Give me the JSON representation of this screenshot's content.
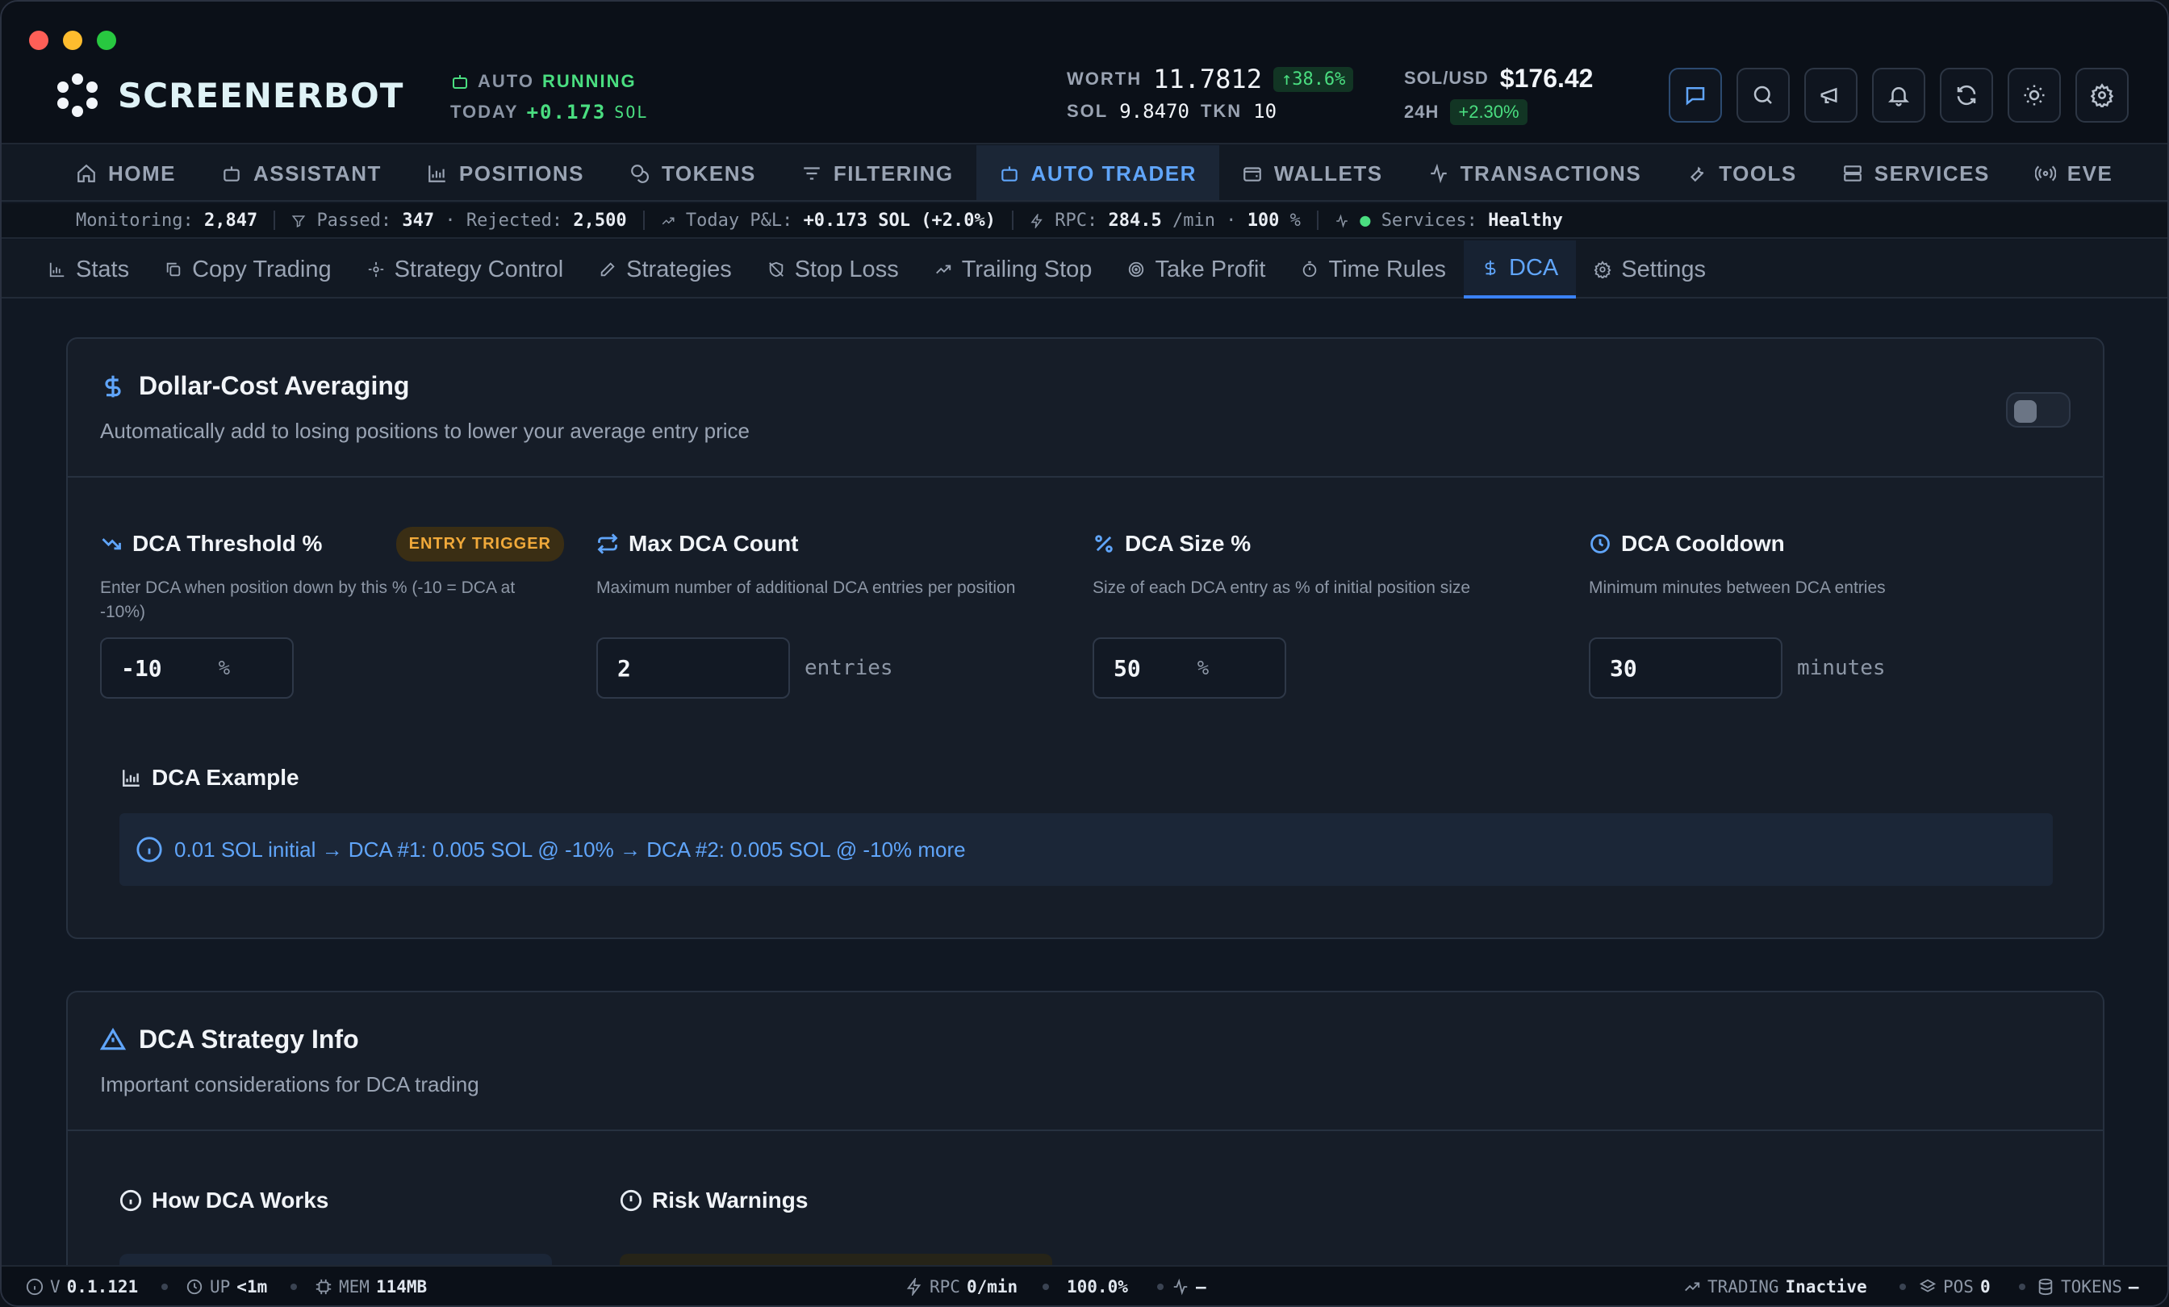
{
  "header": {
    "logo": "SCREENERBOT",
    "auto": {
      "label": "AUTO",
      "state": "RUNNING"
    },
    "today": {
      "label": "TODAY",
      "value": "+0.173",
      "unit": "SOL"
    },
    "worth": {
      "label": "WORTH",
      "value": "11.7812",
      "change": "↑38.6%"
    },
    "sol": {
      "label": "SOL",
      "value": "9.8470",
      "tkn_label": "TKN",
      "tkn_value": "10"
    },
    "solusd": {
      "label": "SOL/USD",
      "value": "$176.42",
      "h24_label": "24H",
      "h24_value": "+2.30%"
    },
    "icon_buttons": [
      "chat-icon",
      "search-icon",
      "megaphone-icon",
      "bell-icon",
      "refresh-icon",
      "sun-icon",
      "gear-icon"
    ]
  },
  "nav": {
    "items": [
      {
        "label": "HOME",
        "icon": "home-icon"
      },
      {
        "label": "ASSISTANT",
        "icon": "bot-icon"
      },
      {
        "label": "POSITIONS",
        "icon": "chart-icon"
      },
      {
        "label": "TOKENS",
        "icon": "coins-icon"
      },
      {
        "label": "FILTERING",
        "icon": "filter-icon"
      },
      {
        "label": "AUTO TRADER",
        "icon": "bot-icon",
        "active": true
      },
      {
        "label": "WALLETS",
        "icon": "wallet-icon"
      },
      {
        "label": "TRANSACTIONS",
        "icon": "activity-icon"
      },
      {
        "label": "TOOLS",
        "icon": "wrench-icon"
      },
      {
        "label": "SERVICES",
        "icon": "server-icon"
      },
      {
        "label": "EVE",
        "icon": "radio-icon"
      }
    ]
  },
  "status": {
    "monitoring_label": "Monitoring:",
    "monitoring": "2,847",
    "passed_label": "Passed:",
    "passed": "347",
    "rejected_label": "Rejected:",
    "rejected": "2,500",
    "pnl_label": "Today P&L:",
    "pnl": "+0.173 SOL (+2.0%)",
    "rpc_label": "RPC:",
    "rpc": "284.5",
    "rpc_unit": "/min",
    "rpc_pct": "100",
    "services_label": "Services:",
    "services": "Healthy"
  },
  "subnav": {
    "items": [
      {
        "label": "Stats"
      },
      {
        "label": "Copy Trading"
      },
      {
        "label": "Strategy Control"
      },
      {
        "label": "Strategies"
      },
      {
        "label": "Stop Loss"
      },
      {
        "label": "Trailing Stop"
      },
      {
        "label": "Take Profit"
      },
      {
        "label": "Time Rules"
      },
      {
        "label": "DCA",
        "active": true
      },
      {
        "label": "Settings"
      }
    ]
  },
  "dca": {
    "title": "Dollar-Cost Averaging",
    "subtitle": "Automatically add to losing positions to lower your average entry price",
    "enabled": false,
    "fields": [
      {
        "label": "DCA Threshold %",
        "badge": "ENTRY TRIGGER",
        "desc": "Enter DCA when position down by this % (-10 = DCA at -10%)",
        "value": "-10",
        "unit": "%"
      },
      {
        "label": "Max DCA Count",
        "desc": "Maximum number of additional DCA entries per position",
        "value": "2",
        "unit": "entries"
      },
      {
        "label": "DCA Size %",
        "desc": "Size of each DCA entry as % of initial position size",
        "value": "50",
        "unit": "%"
      },
      {
        "label": "DCA Cooldown",
        "desc": "Minimum minutes between DCA entries",
        "value": "30",
        "unit": "minutes"
      }
    ],
    "example_title": "DCA Example",
    "example_text": "0.01 SOL initial → DCA #1: 0.005 SOL @ -10% → DCA #2: 0.005 SOL @ -10% more"
  },
  "info": {
    "title": "DCA Strategy Info",
    "subtitle": "Important considerations for DCA trading",
    "how": "How DCA Works",
    "risk": "Risk Warnings"
  },
  "footer": {
    "version_label": "V",
    "version": "0.1.121",
    "up_label": "UP",
    "up": "<1m",
    "mem_label": "MEM",
    "mem": "114MB",
    "rpc_label": "RPC",
    "rpc": "0/min",
    "pct": "100.0%",
    "activity": "–",
    "trading_label": "TRADING",
    "trading": "Inactive",
    "pos_label": "POS",
    "pos": "0",
    "tokens_label": "TOKENS",
    "tokens": "–"
  }
}
